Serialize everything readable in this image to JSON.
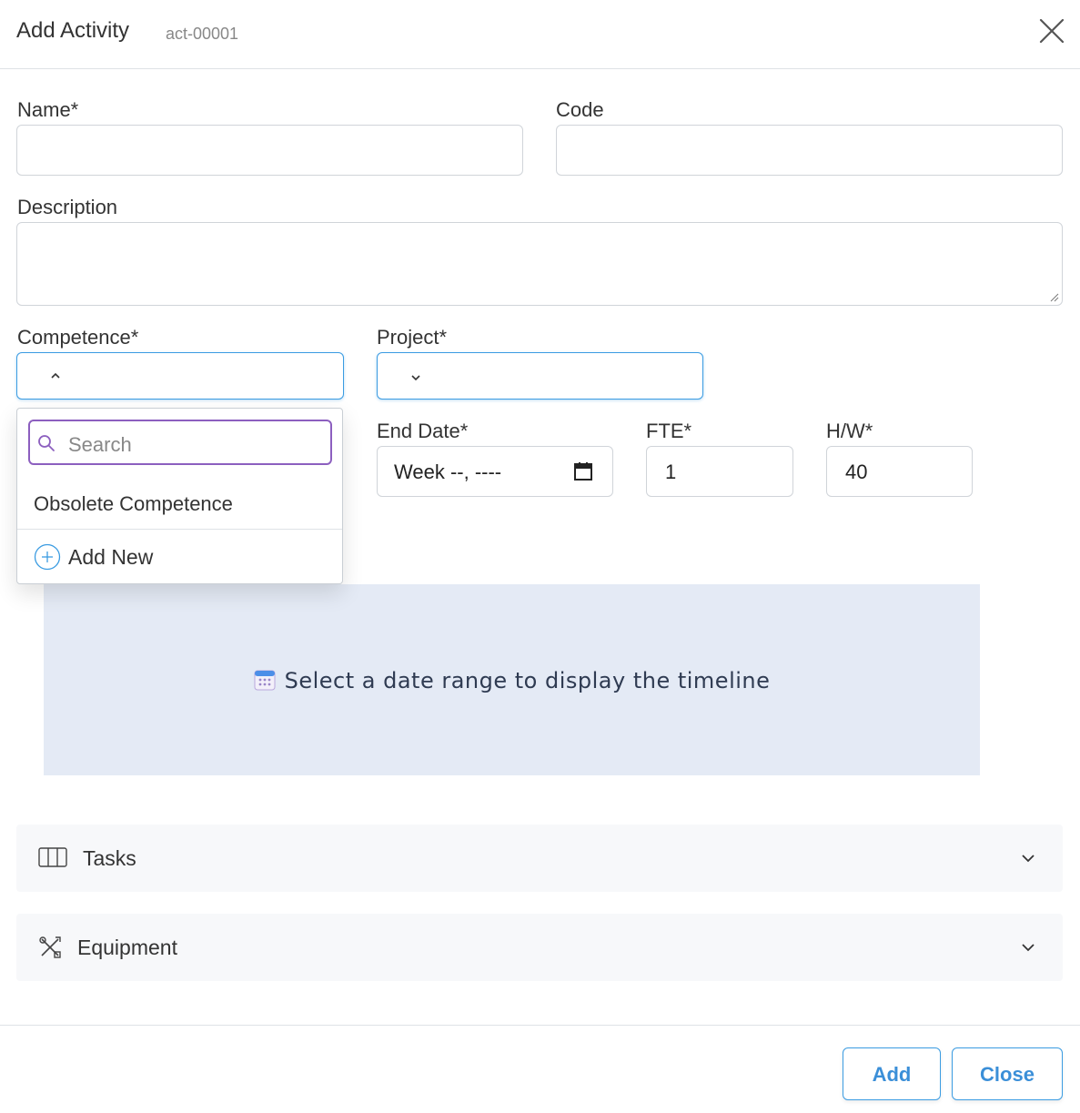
{
  "header": {
    "title": "Add Activity",
    "activity_id": "act-00001"
  },
  "form": {
    "name": {
      "label": "Name*",
      "value": ""
    },
    "code": {
      "label": "Code",
      "value": ""
    },
    "description": {
      "label": "Description",
      "value": ""
    },
    "competence": {
      "label": "Competence*",
      "value": ""
    },
    "project": {
      "label": "Project*",
      "value": ""
    },
    "end_date": {
      "label": "End Date*",
      "value": "Week --, ----"
    },
    "fte": {
      "label": "FTE*",
      "value": "1"
    },
    "hw": {
      "label": "H/W*",
      "value": "40"
    }
  },
  "dropdown": {
    "search_placeholder": "Search",
    "options": [
      "Obsolete Competence"
    ],
    "add_new_label": "Add New"
  },
  "timeline": {
    "message": "Select a date range to display the timeline"
  },
  "sections": [
    {
      "label": "Tasks",
      "icon": "columns-icon",
      "expanded": false
    },
    {
      "label": "Equipment",
      "icon": "tools-icon",
      "expanded": false
    }
  ],
  "footer": {
    "add_label": "Add",
    "close_label": "Close"
  },
  "colors": {
    "accent": "#3b9ce2",
    "search_focus": "#8c5fbf",
    "timeline_bg": "#e4eaf5"
  }
}
